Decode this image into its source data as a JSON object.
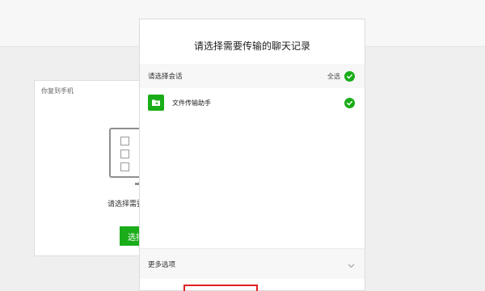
{
  "back_dialog": {
    "title": "你复到手机",
    "description": "请选择需要",
    "button_label": "选择"
  },
  "front_dialog": {
    "title": "请选择需要传输的聊天记录",
    "section_label": "请选择会话",
    "select_all_label": "全选",
    "select_all_checked": true,
    "chats": [
      {
        "name": "文件传输助手",
        "checked": true,
        "icon": "folder-icon"
      }
    ],
    "more_options_label": "更多选项"
  },
  "colors": {
    "accent": "#1aad19",
    "highlight": "#e02020"
  }
}
